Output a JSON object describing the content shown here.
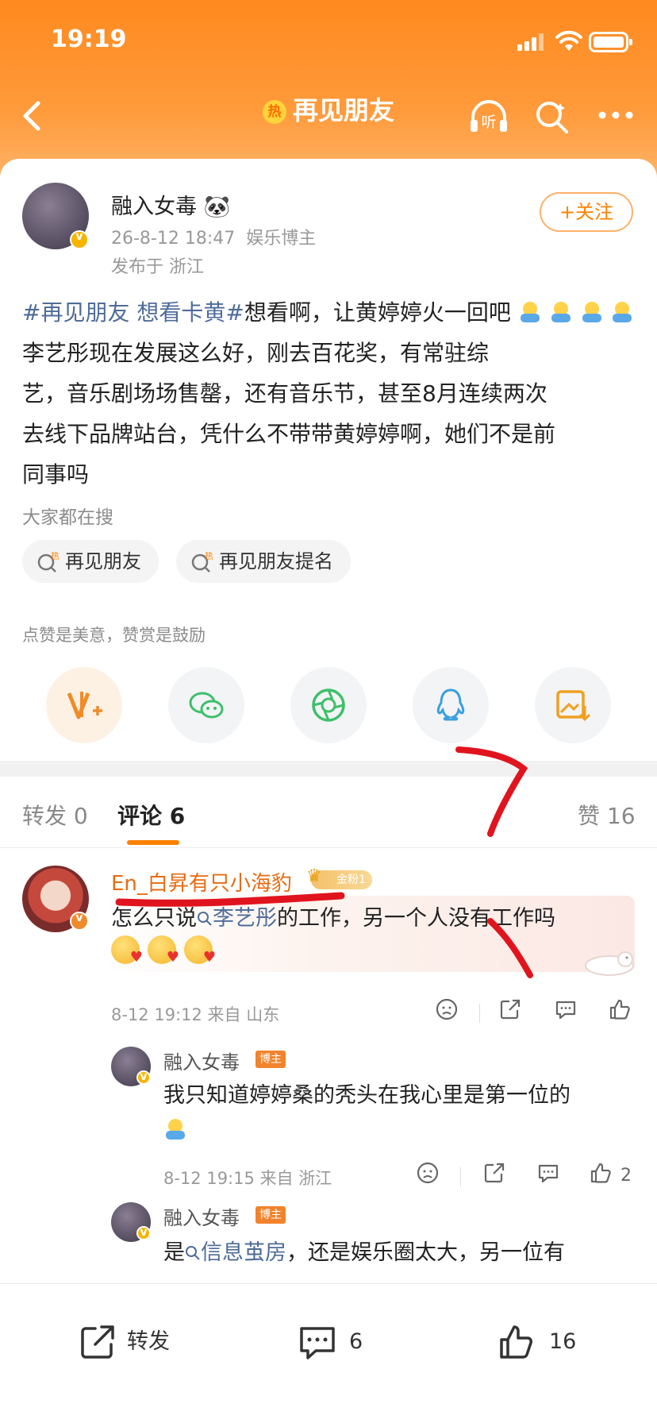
{
  "status_bar": {
    "time": "19:19"
  },
  "nav": {
    "title": "再见朋友",
    "hot_badge": "热",
    "listen_label": "听"
  },
  "post": {
    "author": "融入女毒",
    "author_emoji": "🐼",
    "date": "26-8-12 18:47",
    "role": "娱乐博主",
    "location": "发布于 浙江",
    "follow_label": "+关注",
    "tags": "#再见朋友 想看卡黄#",
    "line1": "想看啊，让黄婷婷火一回吧",
    "line2": "李艺彤现在发展这么好，刚去百花奖，有常驻综",
    "line3": "艺，音乐剧场场售罄，还有音乐节，甚至8月连续两次",
    "line4": "去线下品牌站台，凭什么不带带黄婷婷啊，她们不是前",
    "line5": "同事吗"
  },
  "search": {
    "title": "大家都在搜",
    "chips": [
      "再见朋友",
      "再见朋友提名"
    ],
    "hot_mark": "热"
  },
  "reward": {
    "title": "点赞是美意，赞赏是鼓励"
  },
  "tabs": {
    "repost": "转发 0",
    "comment_label": "评论",
    "comment_count": "6",
    "like": "赞 16"
  },
  "comments": [
    {
      "user": "En_白昇有只小海豹",
      "fan_badge": "金粉1",
      "text_before": "怎么只说",
      "keyword": "李艺彤",
      "text_after": "的工作，另一个人没有工作吗",
      "meta": "8-12 19:12 来自 山东"
    }
  ],
  "replies": [
    {
      "user": "融入女毒",
      "badge": "博主",
      "text": "我只知道婷婷桑的秃头在我心里是第一位的",
      "meta": "8-12 19:15 来自 浙江",
      "likes": "2"
    },
    {
      "user": "融入女毒",
      "badge": "博主",
      "text_before": "是",
      "keyword": "信息茧房",
      "text_after": "，还是娱乐圈太大，另一位有"
    }
  ],
  "bottom_bar": {
    "repost": "转发",
    "comments": "6",
    "likes": "16"
  },
  "colors": {
    "accent": "#ff8200",
    "link": "#4f6c9a",
    "header": "#ff8a1f",
    "annotation": "#e0141e"
  }
}
